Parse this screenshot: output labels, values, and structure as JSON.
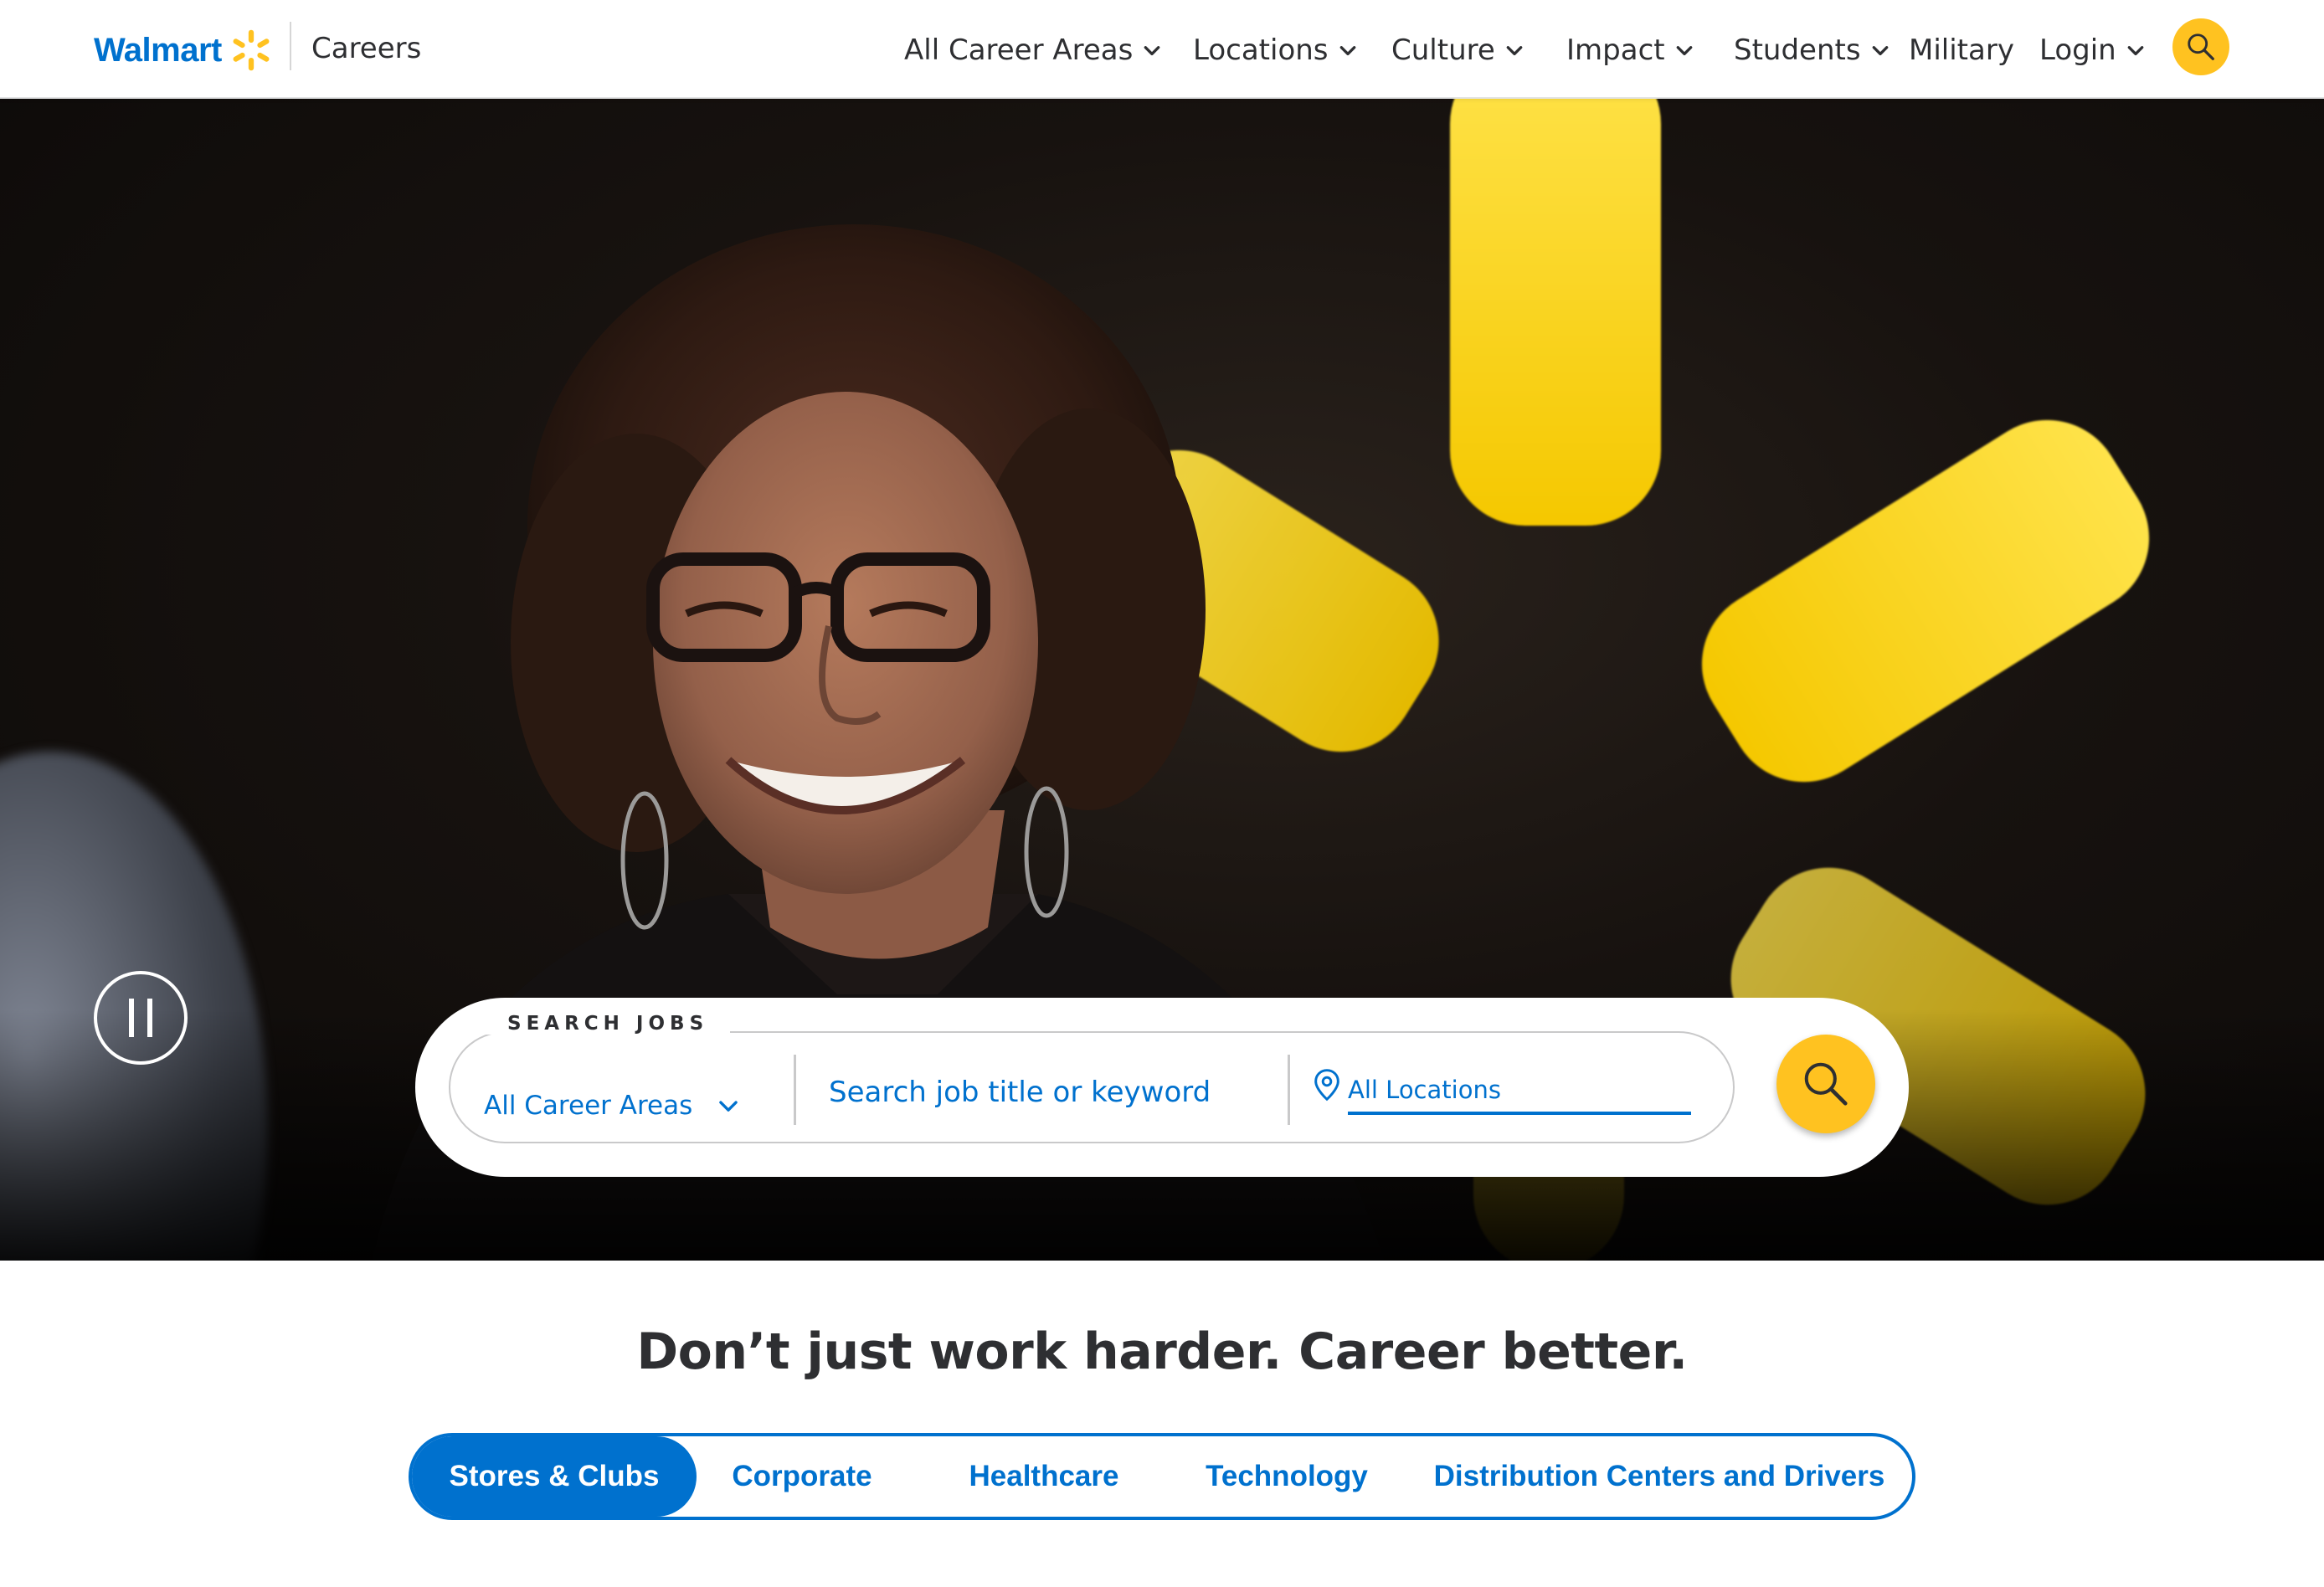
{
  "brand": {
    "wordmark": "Walmart",
    "section": "Careers",
    "colors": {
      "blue": "#0071ce",
      "yellow": "#ffc220",
      "text": "#2e2f32"
    }
  },
  "nav": {
    "items": [
      {
        "label": "All Career Areas",
        "has_dropdown": true
      },
      {
        "label": "Locations",
        "has_dropdown": true
      },
      {
        "label": "Culture",
        "has_dropdown": true
      },
      {
        "label": "Impact",
        "has_dropdown": true
      },
      {
        "label": "Students",
        "has_dropdown": true
      },
      {
        "label": "Military",
        "has_dropdown": false
      },
      {
        "label": "Login",
        "has_dropdown": true
      }
    ],
    "search_icon": "search-icon"
  },
  "hero": {
    "media_control": "pause-icon"
  },
  "search": {
    "label": "SEARCH JOBS",
    "career_area": "All Career Areas",
    "keyword_placeholder": "Search job title or keyword",
    "location": "All Locations",
    "submit_icon": "search-icon"
  },
  "tagline": "Don’t just work harder. Career better.",
  "tabs": [
    {
      "label": "Stores & Clubs",
      "active": true
    },
    {
      "label": "Corporate",
      "active": false
    },
    {
      "label": "Healthcare",
      "active": false
    },
    {
      "label": "Technology",
      "active": false
    },
    {
      "label": "Distribution Centers and Drivers",
      "active": false
    }
  ]
}
